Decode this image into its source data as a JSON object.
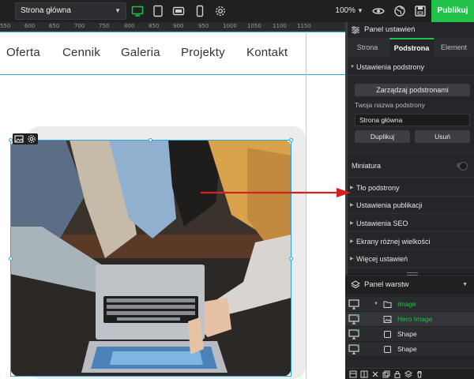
{
  "toolbar": {
    "page_select": "Strona główna",
    "zoom": "100%",
    "publish": "Publikuj",
    "icons": [
      "desktop-icon",
      "tablet-icon",
      "tablet-landscape-icon",
      "mobile-icon",
      "gear-icon",
      "eye-icon",
      "globe-icon",
      "save-icon"
    ],
    "accent": "#22c24a"
  },
  "ruler": {
    "ticks": [
      "550",
      "600",
      "650",
      "700",
      "750",
      "800",
      "850",
      "900",
      "950",
      "1000",
      "1050",
      "1100",
      "1150"
    ]
  },
  "nav": {
    "items": [
      "Oferta",
      "Cennik",
      "Galeria",
      "Projekty",
      "Kontakt"
    ]
  },
  "hero": {
    "icon": "image-icon",
    "settings_icon": "gear-icon"
  },
  "panel": {
    "title": "Panel ustawień",
    "tabs": [
      "Strona",
      "Podstrona",
      "Element"
    ],
    "active_tab": "Podstrona",
    "section_title": "Ustawienia podstrony",
    "manage_button": "Zarządzaj podstronami",
    "name_label": "Twoja nazwa podstrony",
    "name_value": "Strona główna",
    "duplicate_button": "Duplikuj",
    "delete_button": "Usuń",
    "thumbnail_label": "Miniatura",
    "sections": [
      "Tło podstrony",
      "Ustawienia publikacji",
      "Ustawienia SEO",
      "Ekrany różnej wielkości",
      "Więcej ustawień"
    ]
  },
  "layers": {
    "title": "Panel warstw",
    "items": [
      {
        "name": "Image",
        "type": "folder-icon",
        "highlight": true
      },
      {
        "name": "Hero Image",
        "type": "image-icon",
        "highlight": true
      },
      {
        "name": "Shape",
        "type": "square-icon",
        "highlight": false
      },
      {
        "name": "Shape",
        "type": "square-icon",
        "highlight": false
      }
    ]
  }
}
